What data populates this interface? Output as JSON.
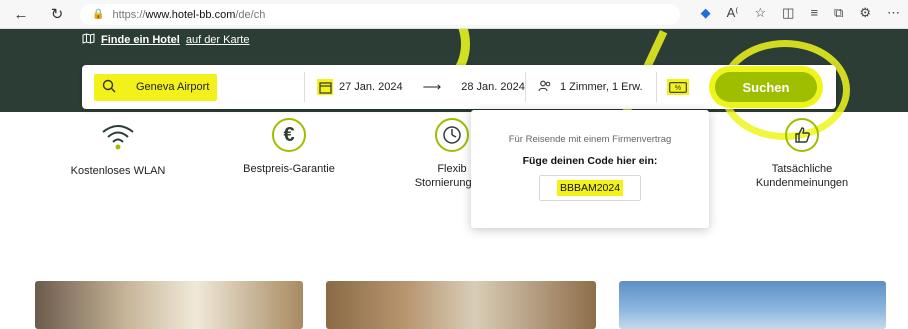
{
  "browser": {
    "url_prefix": "https://",
    "url_host": "www.hotel-bb.com",
    "url_path": "/de/ch"
  },
  "hero": {
    "map_link_bold": "Finde ein Hotel",
    "map_link_rest": "auf der Karte"
  },
  "search": {
    "destination": "Geneva Airport",
    "checkin": "27 Jan. 2024",
    "checkout": "28 Jan. 2024",
    "guests": "1 Zimmer, 1 Erw.",
    "button": "Suchen"
  },
  "features": [
    {
      "label": "Kostenloses WLAN",
      "icon": "wifi-icon"
    },
    {
      "label": "Bestpreis-Garantie",
      "icon": "euro-icon"
    },
    {
      "label": "Flexib",
      "label2": "Stornierungsbe",
      "icon": "clock-icon"
    },
    {
      "label": "Tatsächliche",
      "label2": "Kundenmeinungen",
      "icon": "thumbs-up-icon"
    }
  ],
  "popup": {
    "note": "Für Reisende mit einem Firmenvertrag",
    "prompt": "Füge deinen Code hier ein:",
    "code": "BBBAM2024"
  },
  "colors": {
    "brand_green": "#a0be00",
    "hero_bg": "#2c3d36",
    "highlight": "#f2f21a"
  }
}
